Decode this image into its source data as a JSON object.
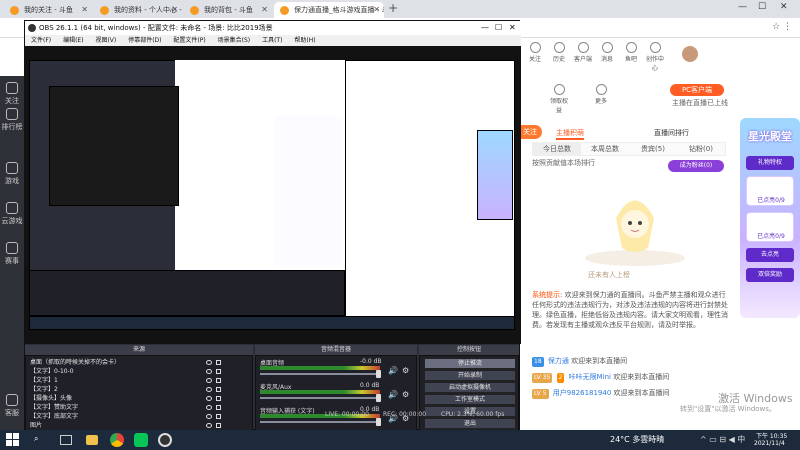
{
  "browser": {
    "tabs": [
      {
        "label": "我的关注 - 斗鱼"
      },
      {
        "label": "我的资料 - 个人中心 - 斗鱼"
      },
      {
        "label": "我的背包 - 斗鱼"
      },
      {
        "label": "保力通直播_格斗游戏直播 - 斗鱼直"
      }
    ],
    "new_tab": "+",
    "window_controls": {
      "min": "—",
      "max": "☐",
      "close": "✕"
    },
    "address_right_icons": "☆ ⋮"
  },
  "left_sidebar": {
    "items": [
      {
        "label": "关注",
        "icon": "heart-icon"
      },
      {
        "label": "排行榜",
        "icon": "trophy-icon"
      },
      {
        "label": "游戏",
        "icon": "gamepad-icon"
      },
      {
        "label": "云游戏",
        "icon": "cloud-icon"
      },
      {
        "label": "赛事",
        "icon": "cup-icon"
      },
      {
        "label": "客服",
        "icon": "headset-icon"
      }
    ]
  },
  "obs": {
    "title": "OBS 26.1.1 (64 bit, windows) - 配置文件: 未命名 - 场景: 比比2019场景",
    "menu": [
      "文件(F)",
      "编辑(E)",
      "视图(V)",
      "停靠部件(D)",
      "配置文件(P)",
      "场景集合(S)",
      "工具(T)",
      "帮助(H)"
    ],
    "panels": {
      "sources": "来源",
      "mixer": "音频混音器",
      "controls": "控制按钮"
    },
    "sources": [
      {
        "label": "桌面（抓取的時候关掉不的会卡）"
      },
      {
        "label": "【文字】0-10-0"
      },
      {
        "label": "【文字】1"
      },
      {
        "label": "【文字】2"
      },
      {
        "label": "【摄像头】头像"
      },
      {
        "label": "【文字】赞助文字"
      },
      {
        "label": "【文字】底部文字"
      },
      {
        "label": "图片"
      }
    ],
    "mixer": [
      {
        "name": "桌面音频",
        "level": "-0.0 dB"
      },
      {
        "name": "麦克风/Aux",
        "level": "0.0 dB"
      },
      {
        "name": "音频输入捕获 (文字)",
        "level": "0.0 dB"
      }
    ],
    "controls": [
      "停止推流",
      "开始录制",
      "启动虚拟摄像机",
      "工作室模式",
      "设置",
      "退出"
    ],
    "status": {
      "live": "LIVE: 00:00:00",
      "rec": "REC: 00:00:00",
      "cpu": "CPU: 2.3%, 60.00 fps"
    }
  },
  "douyu": {
    "top_icons": [
      {
        "label": "关注",
        "icon": "star-icon"
      },
      {
        "label": "历史",
        "icon": "clock-icon"
      },
      {
        "label": "客户端",
        "icon": "monitor-icon"
      },
      {
        "label": "消息",
        "icon": "bell-icon"
      },
      {
        "label": "鱼吧",
        "icon": "fish-icon"
      },
      {
        "label": "创作中心",
        "icon": "pen-icon"
      }
    ],
    "second_row": [
      {
        "label": "领取权益"
      },
      {
        "label": "更多"
      }
    ],
    "pc_button": "PC客户端",
    "pc_sub": "主播在直播已上线",
    "follow_tag": "关注",
    "rank_tabs": [
      "主播积萌",
      "直播间排行"
    ],
    "rank_cols": [
      "今日总数",
      "本周总数",
      "贵宾(5)",
      "钻粉(0)"
    ],
    "day_rank": "按照贡献值本场排行",
    "cheer_btn": "成为粉丝(0)",
    "empty_text": "还未有人上榜",
    "system_label": "系统提示:",
    "system_msg": "欢迎来到保力通的直播间。斗鱼严禁主播和观众进行任何形式的违法违规行为，对涉及违法违规的内容将进行封禁处理。绿色直播，拒绝低俗及违规内容。请大家文明观看，理性消费。若发现有主播或观众违反平台规则，请及时举报。",
    "chat": [
      {
        "badge": "18",
        "name": "保力通",
        "text": "欢迎来到本直播间"
      },
      {
        "badge": "LV 35",
        "badge2": "2",
        "name": "咔咔无限Mini",
        "text": "欢迎来到本直播间"
      },
      {
        "badge": "LV 5",
        "name": "用户9826181940",
        "text": "欢迎来到本直播间"
      }
    ],
    "promo": {
      "title": "星光殿堂",
      "btn1": "礼物特权",
      "box1": "已点亮0/9",
      "box2": "已点亮0/9",
      "btn2": "去点亮",
      "btn3": "双倍奖励"
    },
    "activation_1": "激活 Windows",
    "activation_2": "转到\"设置\"以激活 Windows。"
  },
  "taskbar": {
    "temp": "24°C 多雲時晴",
    "time": "下午 10:35",
    "date": "2021/11/4"
  }
}
